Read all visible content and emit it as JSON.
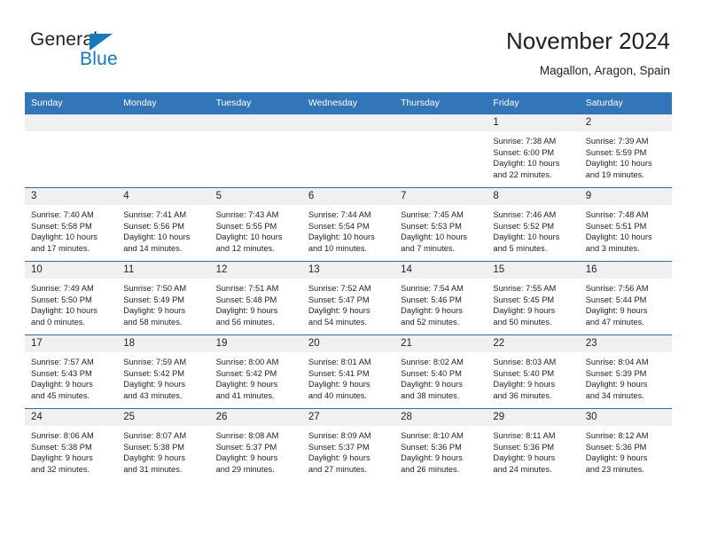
{
  "brand": {
    "name_part1": "General",
    "name_part2": "Blue",
    "logo_icon": "triangle-flag-icon",
    "color_primary": "#1878be",
    "color_text": "#231f20"
  },
  "header": {
    "title": "November 2024",
    "subtitle": "Magallon, Aragon, Spain"
  },
  "theme": {
    "header_blue": "#3275b8",
    "row_divider": "#2c6ca8",
    "daynum_band": "#f0f0f0",
    "page_background": "#ffffff"
  },
  "calendar": {
    "weekday_headers": [
      "Sunday",
      "Monday",
      "Tuesday",
      "Wednesday",
      "Thursday",
      "Friday",
      "Saturday"
    ],
    "weeks": [
      [
        {
          "day": "",
          "blank": true,
          "sunrise": "",
          "sunset": "",
          "daylight_line1": "",
          "daylight_line2": ""
        },
        {
          "day": "",
          "blank": true,
          "sunrise": "",
          "sunset": "",
          "daylight_line1": "",
          "daylight_line2": ""
        },
        {
          "day": "",
          "blank": true,
          "sunrise": "",
          "sunset": "",
          "daylight_line1": "",
          "daylight_line2": ""
        },
        {
          "day": "",
          "blank": true,
          "sunrise": "",
          "sunset": "",
          "daylight_line1": "",
          "daylight_line2": ""
        },
        {
          "day": "",
          "blank": true,
          "sunrise": "",
          "sunset": "",
          "daylight_line1": "",
          "daylight_line2": ""
        },
        {
          "day": "1",
          "blank": false,
          "sunrise": "Sunrise: 7:38 AM",
          "sunset": "Sunset: 6:00 PM",
          "daylight_line1": "Daylight: 10 hours",
          "daylight_line2": "and 22 minutes."
        },
        {
          "day": "2",
          "blank": false,
          "sunrise": "Sunrise: 7:39 AM",
          "sunset": "Sunset: 5:59 PM",
          "daylight_line1": "Daylight: 10 hours",
          "daylight_line2": "and 19 minutes."
        }
      ],
      [
        {
          "day": "3",
          "blank": false,
          "sunrise": "Sunrise: 7:40 AM",
          "sunset": "Sunset: 5:58 PM",
          "daylight_line1": "Daylight: 10 hours",
          "daylight_line2": "and 17 minutes."
        },
        {
          "day": "4",
          "blank": false,
          "sunrise": "Sunrise: 7:41 AM",
          "sunset": "Sunset: 5:56 PM",
          "daylight_line1": "Daylight: 10 hours",
          "daylight_line2": "and 14 minutes."
        },
        {
          "day": "5",
          "blank": false,
          "sunrise": "Sunrise: 7:43 AM",
          "sunset": "Sunset: 5:55 PM",
          "daylight_line1": "Daylight: 10 hours",
          "daylight_line2": "and 12 minutes."
        },
        {
          "day": "6",
          "blank": false,
          "sunrise": "Sunrise: 7:44 AM",
          "sunset": "Sunset: 5:54 PM",
          "daylight_line1": "Daylight: 10 hours",
          "daylight_line2": "and 10 minutes."
        },
        {
          "day": "7",
          "blank": false,
          "sunrise": "Sunrise: 7:45 AM",
          "sunset": "Sunset: 5:53 PM",
          "daylight_line1": "Daylight: 10 hours",
          "daylight_line2": "and 7 minutes."
        },
        {
          "day": "8",
          "blank": false,
          "sunrise": "Sunrise: 7:46 AM",
          "sunset": "Sunset: 5:52 PM",
          "daylight_line1": "Daylight: 10 hours",
          "daylight_line2": "and 5 minutes."
        },
        {
          "day": "9",
          "blank": false,
          "sunrise": "Sunrise: 7:48 AM",
          "sunset": "Sunset: 5:51 PM",
          "daylight_line1": "Daylight: 10 hours",
          "daylight_line2": "and 3 minutes."
        }
      ],
      [
        {
          "day": "10",
          "blank": false,
          "sunrise": "Sunrise: 7:49 AM",
          "sunset": "Sunset: 5:50 PM",
          "daylight_line1": "Daylight: 10 hours",
          "daylight_line2": "and 0 minutes."
        },
        {
          "day": "11",
          "blank": false,
          "sunrise": "Sunrise: 7:50 AM",
          "sunset": "Sunset: 5:49 PM",
          "daylight_line1": "Daylight: 9 hours",
          "daylight_line2": "and 58 minutes."
        },
        {
          "day": "12",
          "blank": false,
          "sunrise": "Sunrise: 7:51 AM",
          "sunset": "Sunset: 5:48 PM",
          "daylight_line1": "Daylight: 9 hours",
          "daylight_line2": "and 56 minutes."
        },
        {
          "day": "13",
          "blank": false,
          "sunrise": "Sunrise: 7:52 AM",
          "sunset": "Sunset: 5:47 PM",
          "daylight_line1": "Daylight: 9 hours",
          "daylight_line2": "and 54 minutes."
        },
        {
          "day": "14",
          "blank": false,
          "sunrise": "Sunrise: 7:54 AM",
          "sunset": "Sunset: 5:46 PM",
          "daylight_line1": "Daylight: 9 hours",
          "daylight_line2": "and 52 minutes."
        },
        {
          "day": "15",
          "blank": false,
          "sunrise": "Sunrise: 7:55 AM",
          "sunset": "Sunset: 5:45 PM",
          "daylight_line1": "Daylight: 9 hours",
          "daylight_line2": "and 50 minutes."
        },
        {
          "day": "16",
          "blank": false,
          "sunrise": "Sunrise: 7:56 AM",
          "sunset": "Sunset: 5:44 PM",
          "daylight_line1": "Daylight: 9 hours",
          "daylight_line2": "and 47 minutes."
        }
      ],
      [
        {
          "day": "17",
          "blank": false,
          "sunrise": "Sunrise: 7:57 AM",
          "sunset": "Sunset: 5:43 PM",
          "daylight_line1": "Daylight: 9 hours",
          "daylight_line2": "and 45 minutes."
        },
        {
          "day": "18",
          "blank": false,
          "sunrise": "Sunrise: 7:59 AM",
          "sunset": "Sunset: 5:42 PM",
          "daylight_line1": "Daylight: 9 hours",
          "daylight_line2": "and 43 minutes."
        },
        {
          "day": "19",
          "blank": false,
          "sunrise": "Sunrise: 8:00 AM",
          "sunset": "Sunset: 5:42 PM",
          "daylight_line1": "Daylight: 9 hours",
          "daylight_line2": "and 41 minutes."
        },
        {
          "day": "20",
          "blank": false,
          "sunrise": "Sunrise: 8:01 AM",
          "sunset": "Sunset: 5:41 PM",
          "daylight_line1": "Daylight: 9 hours",
          "daylight_line2": "and 40 minutes."
        },
        {
          "day": "21",
          "blank": false,
          "sunrise": "Sunrise: 8:02 AM",
          "sunset": "Sunset: 5:40 PM",
          "daylight_line1": "Daylight: 9 hours",
          "daylight_line2": "and 38 minutes."
        },
        {
          "day": "22",
          "blank": false,
          "sunrise": "Sunrise: 8:03 AM",
          "sunset": "Sunset: 5:40 PM",
          "daylight_line1": "Daylight: 9 hours",
          "daylight_line2": "and 36 minutes."
        },
        {
          "day": "23",
          "blank": false,
          "sunrise": "Sunrise: 8:04 AM",
          "sunset": "Sunset: 5:39 PM",
          "daylight_line1": "Daylight: 9 hours",
          "daylight_line2": "and 34 minutes."
        }
      ],
      [
        {
          "day": "24",
          "blank": false,
          "sunrise": "Sunrise: 8:06 AM",
          "sunset": "Sunset: 5:38 PM",
          "daylight_line1": "Daylight: 9 hours",
          "daylight_line2": "and 32 minutes."
        },
        {
          "day": "25",
          "blank": false,
          "sunrise": "Sunrise: 8:07 AM",
          "sunset": "Sunset: 5:38 PM",
          "daylight_line1": "Daylight: 9 hours",
          "daylight_line2": "and 31 minutes."
        },
        {
          "day": "26",
          "blank": false,
          "sunrise": "Sunrise: 8:08 AM",
          "sunset": "Sunset: 5:37 PM",
          "daylight_line1": "Daylight: 9 hours",
          "daylight_line2": "and 29 minutes."
        },
        {
          "day": "27",
          "blank": false,
          "sunrise": "Sunrise: 8:09 AM",
          "sunset": "Sunset: 5:37 PM",
          "daylight_line1": "Daylight: 9 hours",
          "daylight_line2": "and 27 minutes."
        },
        {
          "day": "28",
          "blank": false,
          "sunrise": "Sunrise: 8:10 AM",
          "sunset": "Sunset: 5:36 PM",
          "daylight_line1": "Daylight: 9 hours",
          "daylight_line2": "and 26 minutes."
        },
        {
          "day": "29",
          "blank": false,
          "sunrise": "Sunrise: 8:11 AM",
          "sunset": "Sunset: 5:36 PM",
          "daylight_line1": "Daylight: 9 hours",
          "daylight_line2": "and 24 minutes."
        },
        {
          "day": "30",
          "blank": false,
          "sunrise": "Sunrise: 8:12 AM",
          "sunset": "Sunset: 5:36 PM",
          "daylight_line1": "Daylight: 9 hours",
          "daylight_line2": "and 23 minutes."
        }
      ]
    ]
  }
}
